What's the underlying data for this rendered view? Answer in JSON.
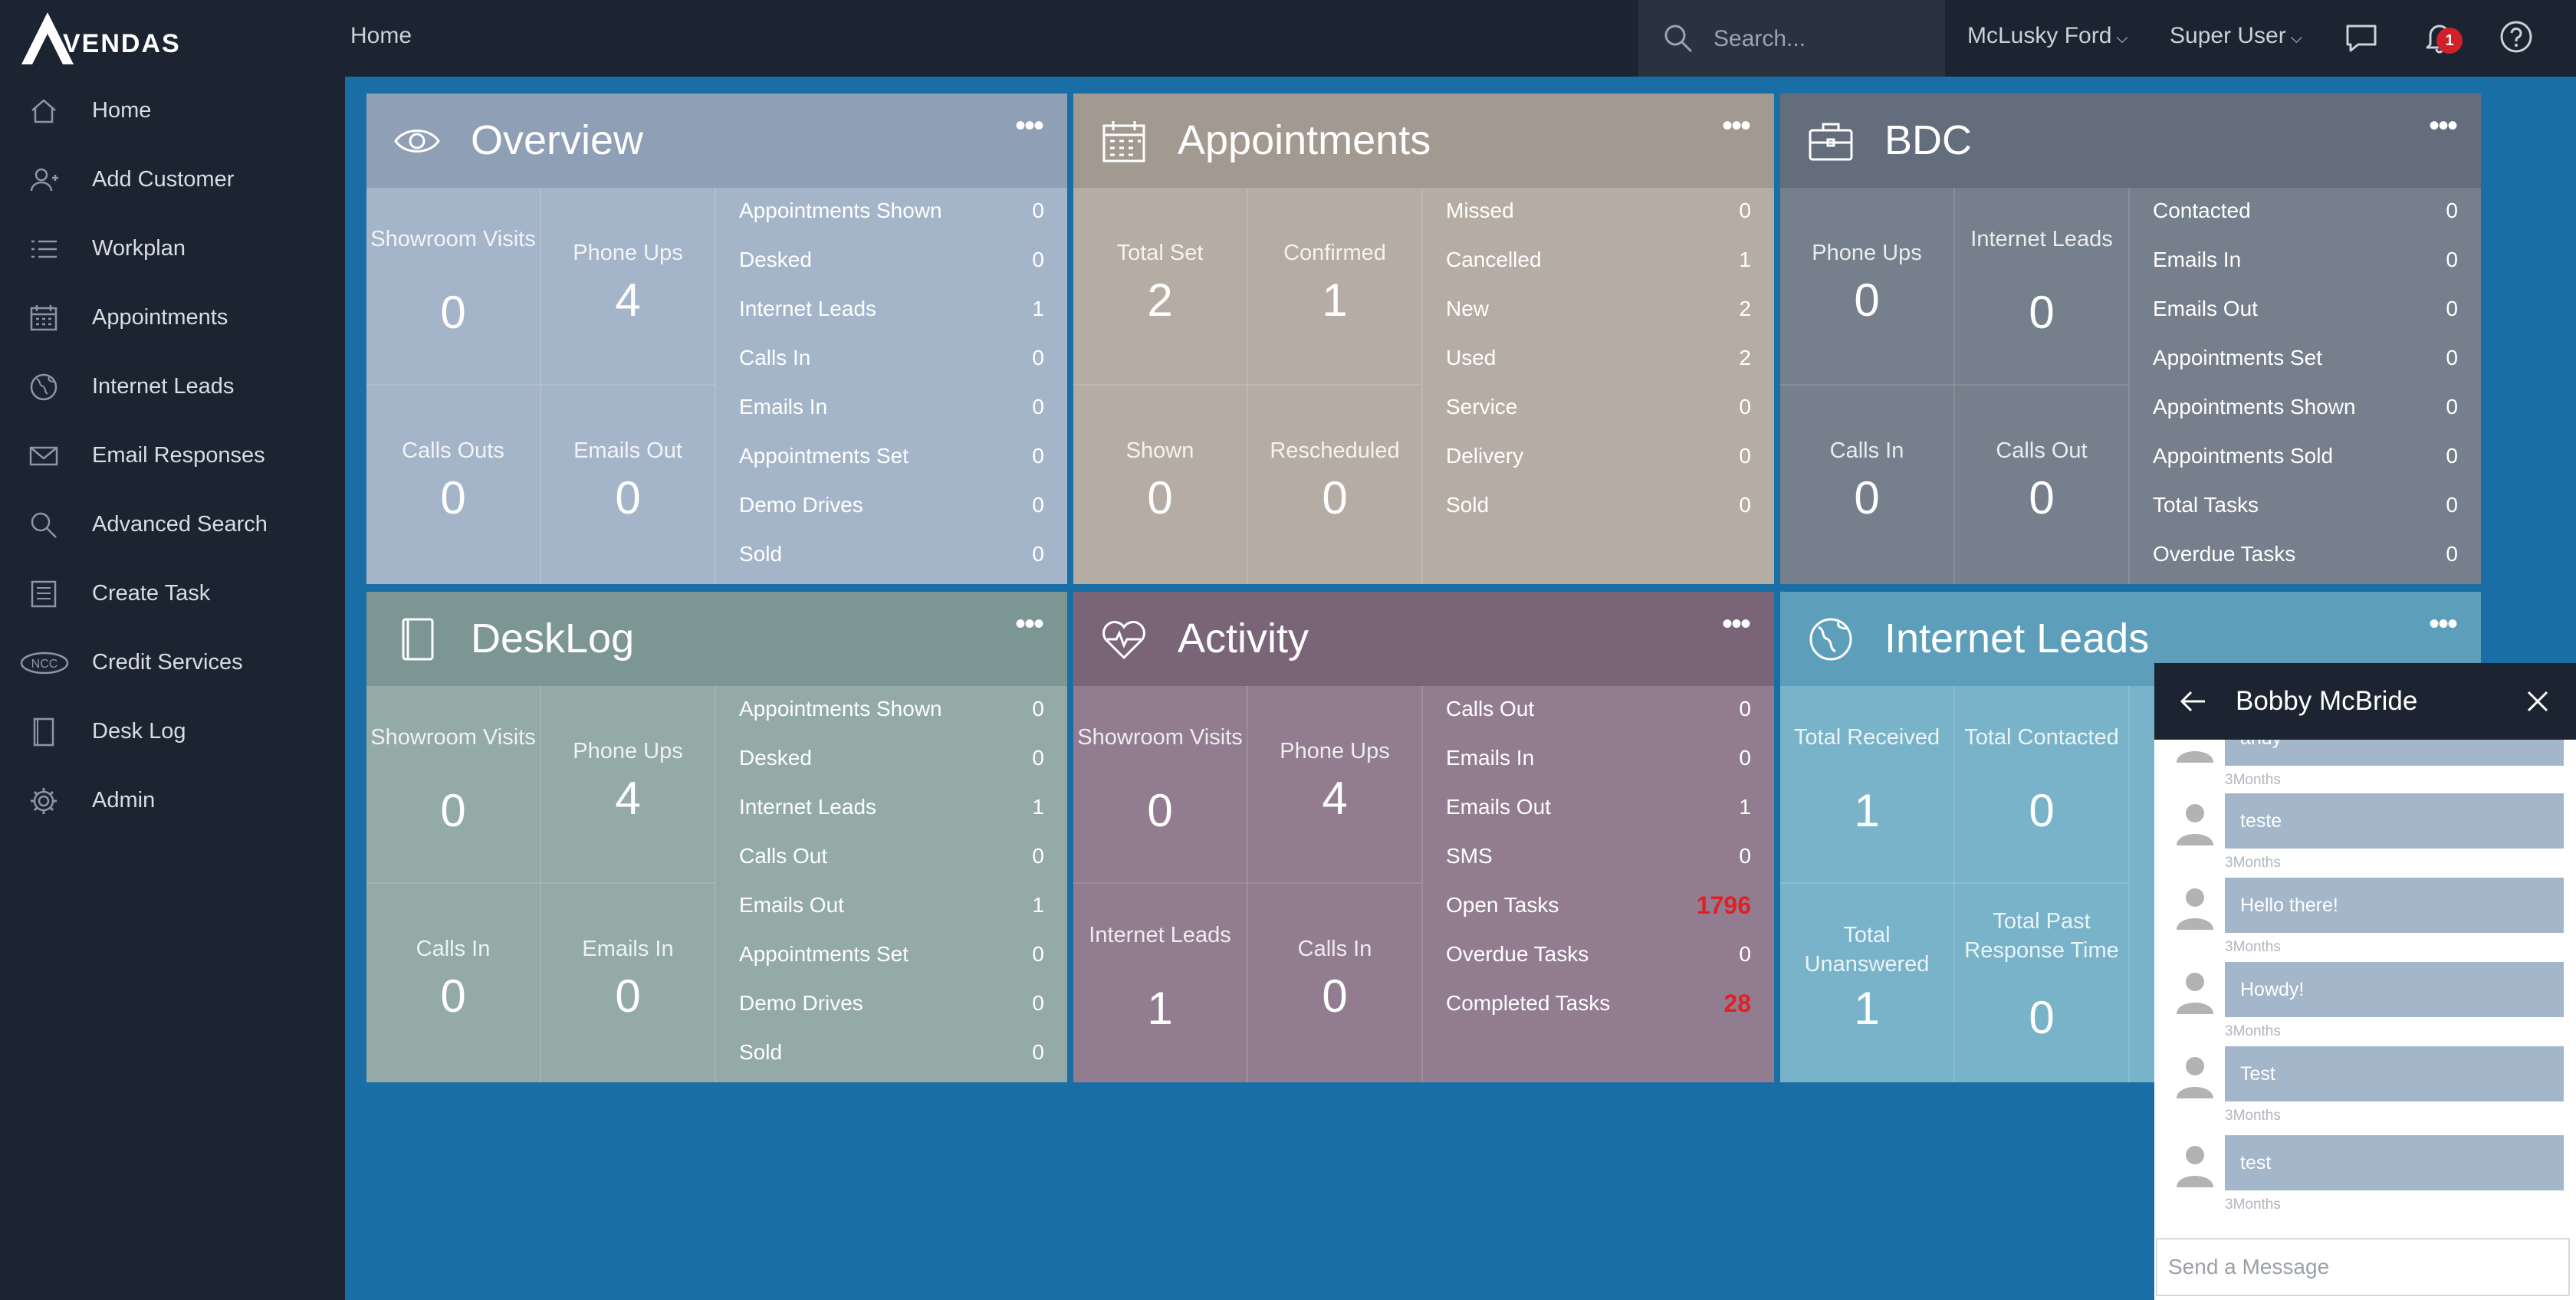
{
  "app": {
    "brand": "VENDAS"
  },
  "header": {
    "breadcrumb": "Home",
    "search_placeholder": "Search...",
    "dealer_menu": "McLusky Ford",
    "user_menu": "Super User",
    "notification_count": "1",
    "chevron": "⌵"
  },
  "sidebar": {
    "items": [
      {
        "label": "Home",
        "icon": "home-icon"
      },
      {
        "label": "Add Customer",
        "icon": "add-user-icon"
      },
      {
        "label": "Workplan",
        "icon": "list-icon"
      },
      {
        "label": "Appointments",
        "icon": "calendar-icon"
      },
      {
        "label": "Internet Leads",
        "icon": "globe-icon"
      },
      {
        "label": "Email Responses",
        "icon": "envelope-icon"
      },
      {
        "label": "Advanced Search",
        "icon": "search-icon"
      },
      {
        "label": "Create Task",
        "icon": "task-icon"
      },
      {
        "label": "Credit Services",
        "icon": "ncc-logo-icon",
        "icon_text": "NCC"
      },
      {
        "label": "Desk Log",
        "icon": "book-icon"
      },
      {
        "label": "Admin",
        "icon": "gear-icon"
      }
    ]
  },
  "widgets": {
    "dots": "•••",
    "overview": {
      "title": "Overview",
      "icon": "eye-icon",
      "colors": {
        "head": "#8f9fb6",
        "body": "#a5b5c9"
      },
      "tiles": [
        {
          "label": "Showroom Visits",
          "value": "0"
        },
        {
          "label": "Phone Ups",
          "value": "4"
        },
        {
          "label": "Calls Outs",
          "value": "0"
        },
        {
          "label": "Emails Out",
          "value": "0"
        }
      ],
      "stats": [
        {
          "label": "Appointments Shown",
          "value": "0"
        },
        {
          "label": "Desked",
          "value": "0"
        },
        {
          "label": "Internet Leads",
          "value": "1"
        },
        {
          "label": "Calls In",
          "value": "0"
        },
        {
          "label": "Emails In",
          "value": "0"
        },
        {
          "label": "Appointments Set",
          "value": "0"
        },
        {
          "label": "Demo Drives",
          "value": "0"
        },
        {
          "label": "Sold",
          "value": "0"
        }
      ]
    },
    "appointments": {
      "title": "Appointments",
      "icon": "calendar-icon",
      "colors": {
        "head": "#a29a90",
        "body": "#b5ada3"
      },
      "tiles": [
        {
          "label": "Total Set",
          "value": "2"
        },
        {
          "label": "Confirmed",
          "value": "1"
        },
        {
          "label": "Shown",
          "value": "0"
        },
        {
          "label": "Rescheduled",
          "value": "0"
        }
      ],
      "stats": [
        {
          "label": "Missed",
          "value": "0"
        },
        {
          "label": "Cancelled",
          "value": "1"
        },
        {
          "label": "New",
          "value": "2"
        },
        {
          "label": "Used",
          "value": "2"
        },
        {
          "label": "Service",
          "value": "0"
        },
        {
          "label": "Delivery",
          "value": "0"
        },
        {
          "label": "Sold",
          "value": "0"
        }
      ]
    },
    "bdc": {
      "title": "BDC",
      "icon": "briefcase-icon",
      "colors": {
        "head": "#646d7b",
        "body": "#767f8c"
      },
      "tiles": [
        {
          "label": "Phone Ups",
          "value": "0"
        },
        {
          "label": "Internet Leads",
          "value": "0"
        },
        {
          "label": "Calls In",
          "value": "0"
        },
        {
          "label": "Calls Out",
          "value": "0"
        }
      ],
      "stats": [
        {
          "label": "Contacted",
          "value": "0"
        },
        {
          "label": "Emails In",
          "value": "0"
        },
        {
          "label": "Emails Out",
          "value": "0"
        },
        {
          "label": "Appointments Set",
          "value": "0"
        },
        {
          "label": "Appointments Shown",
          "value": "0"
        },
        {
          "label": "Appointments Sold",
          "value": "0"
        },
        {
          "label": "Total Tasks",
          "value": "0"
        },
        {
          "label": "Overdue Tasks",
          "value": "0"
        }
      ]
    },
    "desklog": {
      "title": "DeskLog",
      "icon": "book-icon",
      "colors": {
        "head": "#7c9694",
        "body": "#93aaa6"
      },
      "tiles": [
        {
          "label": "Showroom Visits",
          "value": "0"
        },
        {
          "label": "Phone Ups",
          "value": "4"
        },
        {
          "label": "Calls In",
          "value": "0"
        },
        {
          "label": "Emails In",
          "value": "0"
        }
      ],
      "stats": [
        {
          "label": "Appointments Shown",
          "value": "0"
        },
        {
          "label": "Desked",
          "value": "0"
        },
        {
          "label": "Internet Leads",
          "value": "1"
        },
        {
          "label": "Calls Out",
          "value": "0"
        },
        {
          "label": "Emails Out",
          "value": "1"
        },
        {
          "label": "Appointments Set",
          "value": "0"
        },
        {
          "label": "Demo Drives",
          "value": "0"
        },
        {
          "label": "Sold",
          "value": "0"
        }
      ]
    },
    "activity": {
      "title": "Activity",
      "icon": "heartbeat-icon",
      "colors": {
        "head": "#7a6578",
        "body": "#917d8f"
      },
      "tiles": [
        {
          "label": "Showroom Visits",
          "value": "0"
        },
        {
          "label": "Phone Ups",
          "value": "4"
        },
        {
          "label": "Internet Leads",
          "value": "1"
        },
        {
          "label": "Calls In",
          "value": "0"
        }
      ],
      "stats": [
        {
          "label": "Calls Out",
          "value": "0"
        },
        {
          "label": "Emails In",
          "value": "0"
        },
        {
          "label": "Emails Out",
          "value": "1"
        },
        {
          "label": "SMS",
          "value": "0"
        },
        {
          "label": "Open Tasks",
          "value": "1796",
          "highlight": true
        },
        {
          "label": "Overdue Tasks",
          "value": "0"
        },
        {
          "label": "Completed Tasks",
          "value": "28",
          "highlight": true
        }
      ]
    },
    "internet_leads": {
      "title": "Internet Leads",
      "icon": "globe-icon",
      "colors": {
        "head": "#5d9fbb",
        "body": "#79b3ca"
      },
      "tiles": [
        {
          "label": "Total Received",
          "value": "1"
        },
        {
          "label": "Total Contacted",
          "value": "0"
        },
        {
          "label": "Total Unanswered",
          "value": "1"
        },
        {
          "label": "Total Past Response Time",
          "value": "0"
        }
      ]
    }
  },
  "chat": {
    "title": "Bobby McBride",
    "partial_message": {
      "text": "andy",
      "time": "3Months"
    },
    "messages": [
      {
        "text": "teste",
        "time": "3Months"
      },
      {
        "text": "Hello there!",
        "time": "3Months"
      },
      {
        "text": "Howdy!",
        "time": "3Months"
      },
      {
        "text": "Test",
        "time": "3Months"
      },
      {
        "text": "test",
        "time": "3Months"
      }
    ],
    "input_placeholder": "Send a Message"
  }
}
